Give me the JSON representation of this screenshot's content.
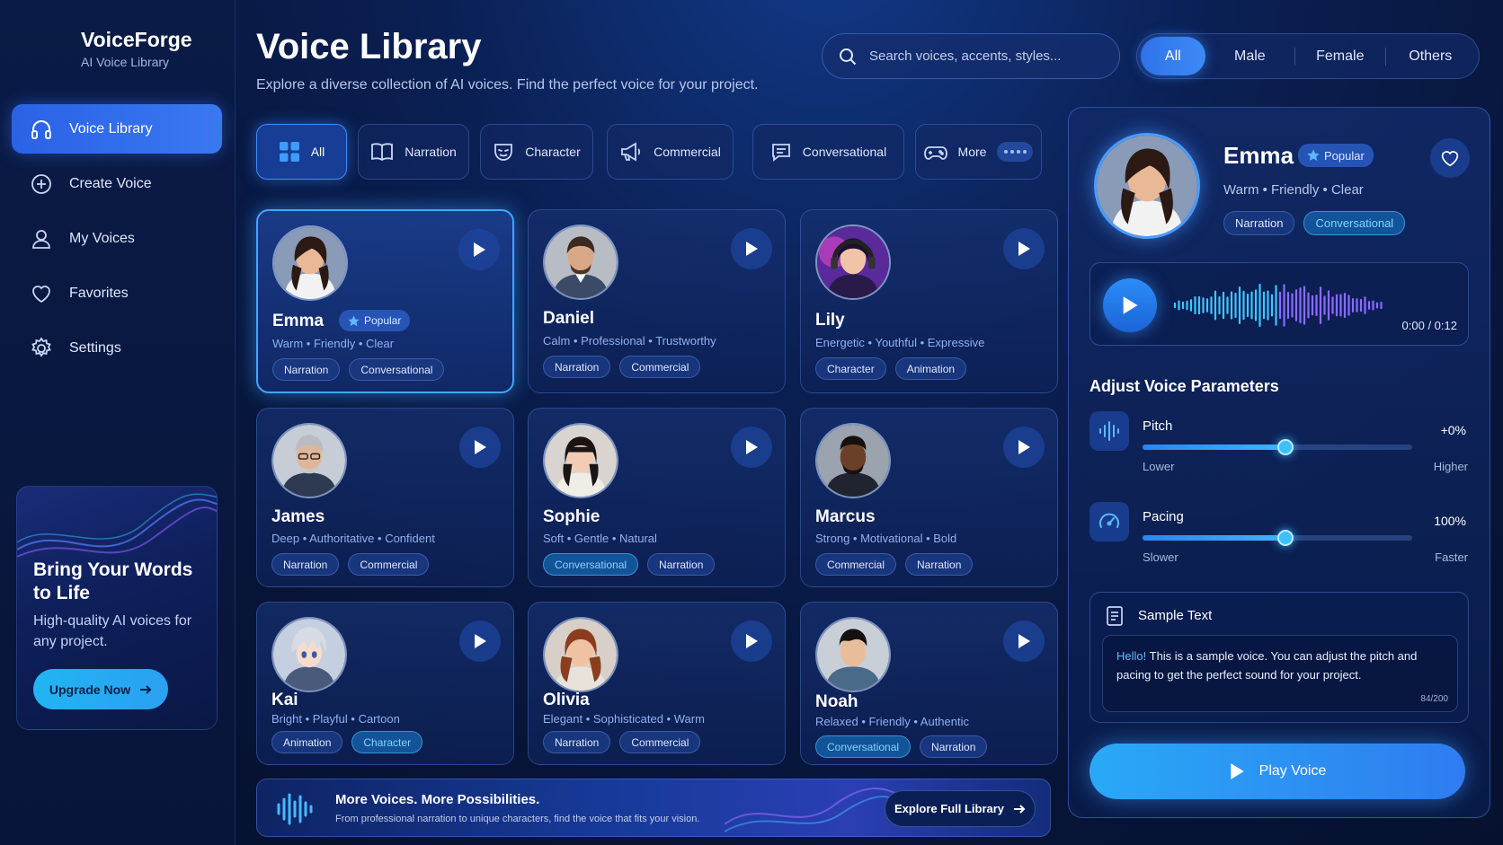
{
  "brand": {
    "name": "VoiceForge",
    "subtitle": "AI Voice Library"
  },
  "sidebar": {
    "items": [
      {
        "label": "Voice Library",
        "icon": "headphones-icon",
        "active": true
      },
      {
        "label": "Create Voice",
        "icon": "plus-circle-icon",
        "active": false
      },
      {
        "label": "My Voices",
        "icon": "user-icon",
        "active": false
      },
      {
        "label": "Favorites",
        "icon": "heart-icon",
        "active": false
      },
      {
        "label": "Settings",
        "icon": "gear-icon",
        "active": false
      }
    ],
    "promo": {
      "title": "Bring Your Words to Life",
      "subtitle": "High-quality AI voices for any project.",
      "button": "Upgrade Now"
    }
  },
  "header": {
    "title": "Voice Library",
    "subtitle": "Explore a diverse collection of AI voices. Find the perfect voice for your project.",
    "search_placeholder": "Search voices, accents, styles...",
    "gender_filters": [
      "All",
      "Male",
      "Female",
      "Others"
    ],
    "gender_active": "All"
  },
  "categories": [
    {
      "label": "All",
      "icon": "grid-icon",
      "active": true
    },
    {
      "label": "Narration",
      "icon": "book-icon",
      "active": false
    },
    {
      "label": "Character",
      "icon": "mask-icon",
      "active": false
    },
    {
      "label": "Commercial",
      "icon": "megaphone-icon",
      "active": false
    },
    {
      "label": "Conversational",
      "icon": "chat-icon",
      "active": false
    },
    {
      "label": "More",
      "icon": "gamepad-icon",
      "active": false
    }
  ],
  "voices": [
    {
      "name": "Emma",
      "traits": [
        "Warm",
        "Friendly",
        "Clear"
      ],
      "tags": [
        "Narration",
        "Conversational"
      ],
      "badge": "Popular",
      "selected": true
    },
    {
      "name": "Daniel",
      "traits": [
        "Calm",
        "Professional",
        "Trustworthy"
      ],
      "tags": [
        "Narration",
        "Commercial"
      ]
    },
    {
      "name": "Lily",
      "traits": [
        "Energetic",
        "Youthful",
        "Expressive"
      ],
      "tags": [
        "Character",
        "Animation"
      ]
    },
    {
      "name": "James",
      "traits": [
        "Deep",
        "Authoritative",
        "Confident"
      ],
      "tags": [
        "Narration",
        "Commercial"
      ]
    },
    {
      "name": "Sophie",
      "traits": [
        "Soft",
        "Gentle",
        "Natural"
      ],
      "tags": [
        "Conversational",
        "Narration"
      ]
    },
    {
      "name": "Marcus",
      "traits": [
        "Strong",
        "Motivational",
        "Bold"
      ],
      "tags": [
        "Commercial",
        "Narration"
      ]
    },
    {
      "name": "Kai",
      "traits": [
        "Bright",
        "Playful",
        "Cartoon"
      ],
      "tags": [
        "Animation",
        "Character"
      ]
    },
    {
      "name": "Olivia",
      "traits": [
        "Elegant",
        "Sophisticated",
        "Warm"
      ],
      "tags": [
        "Narration",
        "Commercial"
      ]
    },
    {
      "name": "Noah",
      "traits": [
        "Relaxed",
        "Friendly",
        "Authentic"
      ],
      "tags": [
        "Conversational",
        "Narration"
      ]
    }
  ],
  "banner": {
    "title": "More Voices. More Possibilities.",
    "subtitle": "From professional narration to unique characters, find the voice that fits your vision.",
    "button": "Explore Full Library"
  },
  "detail": {
    "name": "Emma",
    "badge": "Popular",
    "traits": "Warm • Friendly • Clear",
    "tags": [
      "Narration",
      "Conversational"
    ],
    "time": "0:00 / 0:12",
    "params_title": "Adjust Voice Parameters",
    "pitch": {
      "label": "Pitch",
      "value": "+0%",
      "min_label": "Lower",
      "max_label": "Higher",
      "level": 0.53
    },
    "pacing": {
      "label": "Pacing",
      "value": "100%",
      "min_label": "Slower",
      "max_label": "Faster",
      "level": 0.53
    },
    "sample": {
      "title": "Sample Text",
      "highlight": "Hello!",
      "text": " This is a sample voice. You can adjust the pitch and pacing to get the perfect sound for your project.",
      "count": "84/200"
    },
    "play_button": "Play Voice"
  },
  "colors": {
    "accent": "#3da8ff",
    "primary": "#2f73ea",
    "background": "#071437"
  }
}
